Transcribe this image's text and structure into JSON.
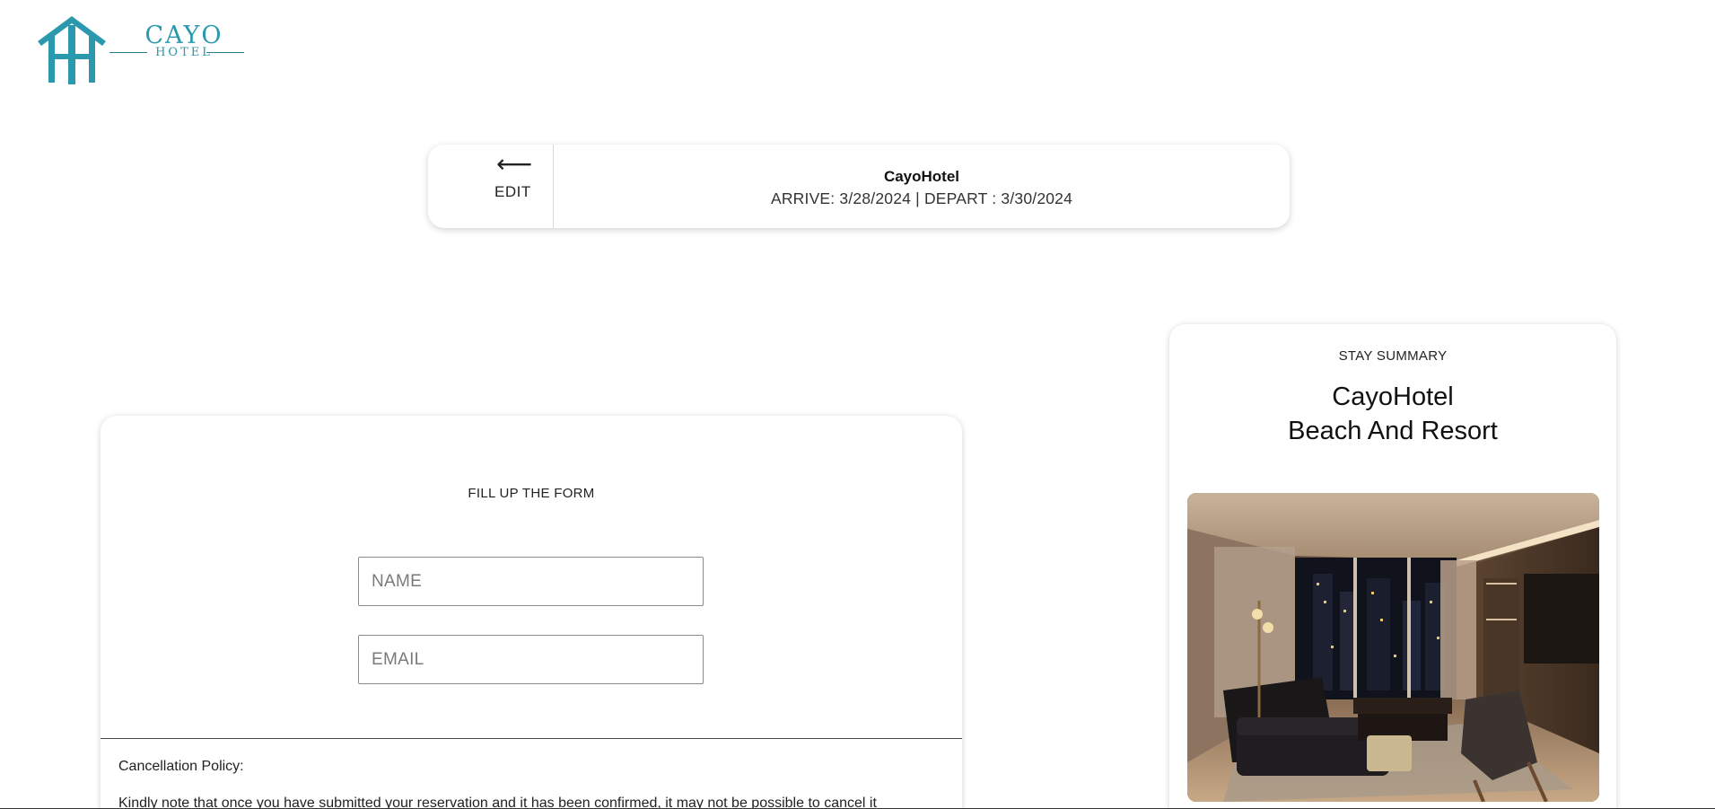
{
  "brand": {
    "logo_word": "CAYO",
    "logo_subword": "HOTEL",
    "accent_color": "#2a98ad"
  },
  "booking_bar": {
    "back_icon": "left-arrow-icon",
    "back_glyph": "⟵",
    "edit_label": "EDIT",
    "hotel_name": "CayoHotel",
    "dates": "ARRIVE: 3/28/2024 | DEPART : 3/30/2024"
  },
  "form": {
    "heading": "FILL UP THE FORM",
    "name_placeholder": "NAME",
    "name_value": "",
    "email_placeholder": "EMAIL",
    "email_value": "",
    "policy_title": "Cancellation Policy:",
    "policy_text": "Kindly note that once you have submitted your reservation and it has been confirmed, it may not be possible to cancel it"
  },
  "summary": {
    "label": "STAY SUMMARY",
    "hotel_line1": "CayoHotel",
    "hotel_line2": "Beach And Resort",
    "image_subject": "hotel-room-photo"
  }
}
